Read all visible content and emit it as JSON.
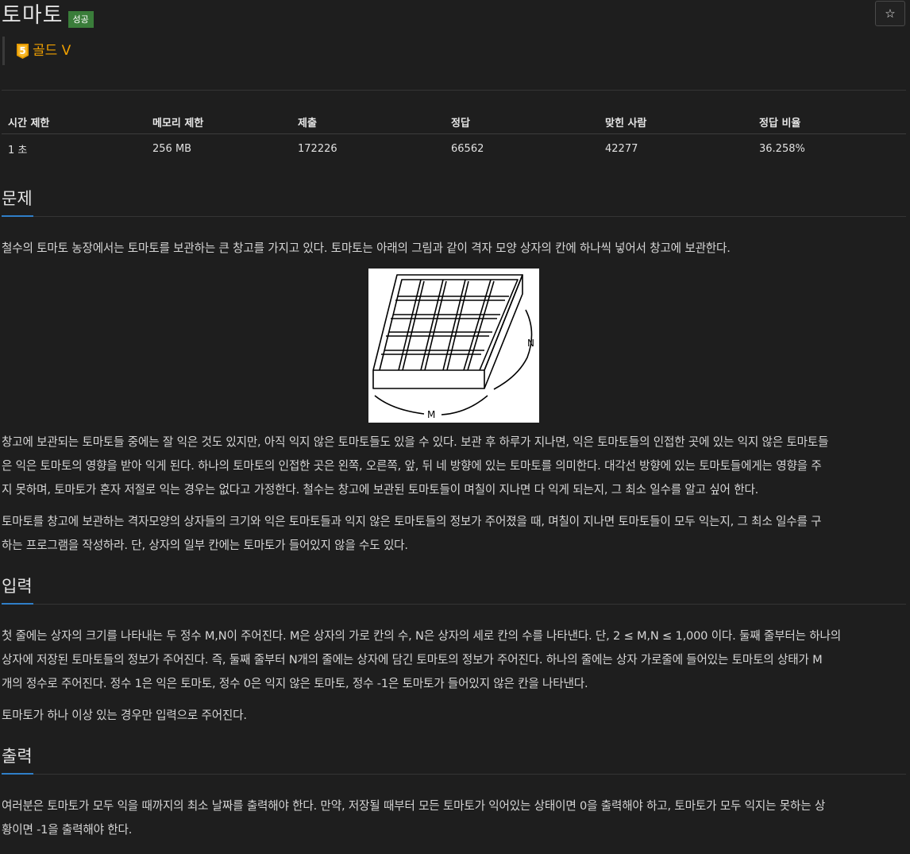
{
  "problem": {
    "title": "토마토",
    "result_badge": "성공",
    "tier_number": "5",
    "tier_label": "골드 V",
    "star_icon": "☆"
  },
  "stats": {
    "headers": [
      "시간 제한",
      "메모리 제한",
      "제출",
      "정답",
      "맞힌 사람",
      "정답 비율"
    ],
    "values": [
      "1 초",
      "256 MB",
      "172226",
      "66562",
      "42277",
      "36.258%"
    ]
  },
  "sections": {
    "problem_title": "문제",
    "input_title": "입력",
    "output_title": "출력"
  },
  "description": {
    "p1": "철수의 토마토 농장에서는 토마토를 보관하는 큰 창고를 가지고 있다. 토마토는 아래의 그림과 같이 격자 모양 상자의 칸에 하나씩 넣어서 창고에 보관한다.",
    "figure_label_n": "N",
    "figure_label_m": "M",
    "p2_l1": "창고에 보관되는 토마토들 중에는 잘 익은 것도 있지만, 아직 익지 않은 토마토들도 있을 수 있다. 보관 후 하루가 지나면, 익은 토마토들의 인접한 곳에 있는 익지 않은 토마토들",
    "p2_l2": "은 익은 토마토의 영향을 받아 익게 된다. 하나의 토마토의 인접한 곳은 왼쪽, 오른쪽, 앞, 뒤 네 방향에 있는 토마토를 의미한다. 대각선 방향에 있는 토마토들에게는 영향을 주",
    "p2_l3": "지 못하며, 토마토가 혼자 저절로 익는 경우는 없다고 가정한다. 철수는 창고에 보관된 토마토들이 며칠이 지나면 다 익게 되는지, 그 최소 일수를 알고 싶어 한다.",
    "p3_l1": "토마토를 창고에 보관하는 격자모양의 상자들의 크기와 익은 토마토들과 익지 않은 토마토들의 정보가 주어졌을 때, 며칠이 지나면 토마토들이 모두 익는지, 그 최소 일수를 구",
    "p3_l2": "하는 프로그램을 작성하라. 단, 상자의 일부 칸에는 토마토가 들어있지 않을 수도 있다."
  },
  "input": {
    "l1": "첫 줄에는 상자의 크기를 나타내는 두 정수 M,N이 주어진다. M은 상자의 가로 칸의 수, N은 상자의 세로 칸의 수를 나타낸다. 단, 2 ≤ M,N ≤ 1,000 이다. 둘째 줄부터는 하나의",
    "l2": "상자에 저장된 토마토들의 정보가 주어진다. 즉, 둘째 줄부터 N개의 줄에는 상자에 담긴 토마토의 정보가 주어진다. 하나의 줄에는 상자 가로줄에 들어있는 토마토의 상태가 M",
    "l3": "개의 정수로 주어진다. 정수 1은 익은 토마토, 정수 0은 익지 않은 토마토, 정수 -1은 토마토가 들어있지 않은 칸을 나타낸다.",
    "l4": "토마토가 하나 이상 있는 경우만 입력으로 주어진다."
  },
  "output": {
    "l1": "여러분은 토마토가 모두 익을 때까지의 최소 날짜를 출력해야 한다. 만약, 저장될 때부터 모든 토마토가 익어있는 상태이면 0을 출력해야 하고, 토마토가 모두 익지는 못하는 상",
    "l2": "황이면 -1을 출력해야 한다."
  },
  "colors": {
    "background": "#1e1e1e",
    "success_badge": "#3a7d3a",
    "tier_gold": "#f0a000",
    "section_accent": "#2f7fc8"
  }
}
